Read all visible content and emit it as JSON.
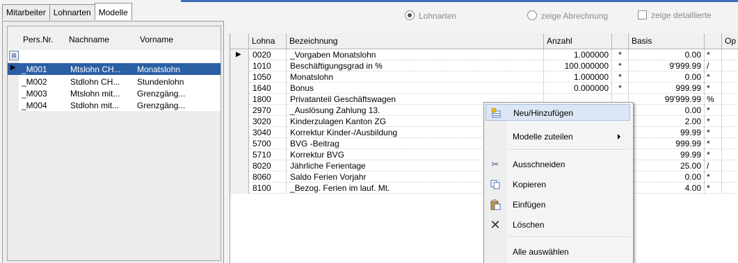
{
  "tabs": [
    "Mitarbeiter",
    "Lohnarten",
    "Modelle"
  ],
  "options": {
    "radio_lohnarten": "Lohnarten",
    "radio_abrechnung": "zeige Abrechnung",
    "checkbox_detail": "zeige detaillierte"
  },
  "left_table": {
    "headers": [
      "Pers.Nr.",
      "Nachname",
      "Vorname"
    ],
    "rows": [
      {
        "nr": "_M001",
        "nachname": "Mtslohn CH...",
        "vorname": "Monatslohn"
      },
      {
        "nr": "_M002",
        "nachname": "Stdlohn CH...",
        "vorname": "Stundenlohn"
      },
      {
        "nr": "_M003",
        "nachname": "Mtslohn mit...",
        "vorname": "Grenzgäng..."
      },
      {
        "nr": "_M004",
        "nachname": "Stdlohn mit...",
        "vorname": "Grenzgäng..."
      }
    ]
  },
  "right_table": {
    "headers": [
      "Lohna",
      "Bezeichnung",
      "Anzahl",
      "",
      "Basis",
      "",
      "Op"
    ],
    "rows": [
      {
        "code": "0020",
        "bez": "_Vorgaben Monatslohn",
        "anzahl": "1.000000",
        "af": "*",
        "basis": "0.00",
        "bf": "*"
      },
      {
        "code": "1010",
        "bez": "Beschäftigungsgrad in %",
        "anzahl": "100.000000",
        "af": "*",
        "basis": "9'999.99",
        "bf": "/"
      },
      {
        "code": "1050",
        "bez": "Monatslohn",
        "anzahl": "1.000000",
        "af": "*",
        "basis": "0.00",
        "bf": "*"
      },
      {
        "code": "1640",
        "bez": "Bonus",
        "anzahl": "0.000000",
        "af": "*",
        "basis": "999.99",
        "bf": "*"
      },
      {
        "code": "1800",
        "bez": "Privatanteil Geschäftswagen",
        "anzahl": "",
        "af": "",
        "basis": "99'999.99",
        "bf": "%"
      },
      {
        "code": "2970",
        "bez": "_Auslösung Zahlung 13.",
        "anzahl": "",
        "af": "",
        "basis": "0.00",
        "bf": "*"
      },
      {
        "code": "3020",
        "bez": "Kinderzulagen Kanton ZG",
        "anzahl": "",
        "af": "",
        "basis": "2.00",
        "bf": "*"
      },
      {
        "code": "3040",
        "bez": "Korrektur Kinder-/Ausbildung",
        "anzahl": "",
        "af": "",
        "basis": "99.99",
        "bf": "*"
      },
      {
        "code": "5700",
        "bez": "BVG -Beitrag",
        "anzahl": "",
        "af": "",
        "basis": "999.99",
        "bf": "*"
      },
      {
        "code": "5710",
        "bez": "Korrektur BVG",
        "anzahl": "",
        "af": "",
        "basis": "99.99",
        "bf": "*"
      },
      {
        "code": "8020",
        "bez": "Jährliche Ferientage",
        "anzahl": "",
        "af": "",
        "basis": "25.00",
        "bf": "/"
      },
      {
        "code": "8060",
        "bez": "Saldo Ferien Vorjahr",
        "anzahl": "",
        "af": "",
        "basis": "0.00",
        "bf": "*"
      },
      {
        "code": "8100",
        "bez": "_Bezog. Ferien im lauf. Mt.",
        "anzahl": "",
        "af": "",
        "basis": "4.00",
        "bf": "*"
      }
    ]
  },
  "context_menu": {
    "items": [
      {
        "label": "Neu/Hinzufügen",
        "icon": "add-row-icon"
      },
      {
        "label": "Modelle zuteilen",
        "icon": "submenu-arrow-icon"
      },
      {
        "label": "Ausschneiden",
        "icon": "scissors-icon"
      },
      {
        "label": "Kopieren",
        "icon": "copy-icon"
      },
      {
        "label": "Einfügen",
        "icon": "paste-icon"
      },
      {
        "label": "Löschen",
        "icon": "delete-x-icon"
      },
      {
        "label": "Alle auswählen",
        "icon": ""
      }
    ]
  }
}
